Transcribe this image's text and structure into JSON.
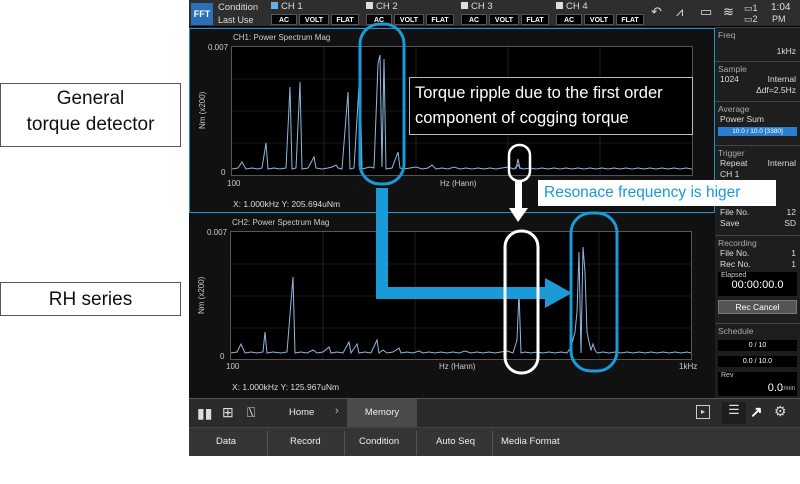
{
  "labels": {
    "general": "General\ntorque detector",
    "rh": "RH series"
  },
  "topbar": {
    "mode": "FFT",
    "condition": "Condition",
    "last_use": "Last Use",
    "channels": [
      {
        "name": "CH 1"
      },
      {
        "name": "CH 2"
      },
      {
        "name": "CH 3"
      },
      {
        "name": "CH 4"
      }
    ],
    "tags": [
      "AC",
      "VOLT",
      "FLAT"
    ],
    "time": "1:04",
    "ampm": "PM",
    "batt1": "1",
    "batt2": "2"
  },
  "side": {
    "freq_h": "Freq",
    "freq_v": "1kHz",
    "sample_h": "Sample",
    "sample_n": "1024",
    "sample_mode": "Internal",
    "sample_df": "Δdf=2.5Hz",
    "avg_h": "Average",
    "avg_mode": "Power Sum",
    "avg_bar": "10.0 / 10.0 [3380]",
    "trig_h": "Trigger",
    "trig_repeat": "Repeat",
    "trig_mode": "Internal",
    "trig_ch": "CH 1",
    "file_no_lbl": "File No.",
    "file_no": "12",
    "save_lbl": "Save",
    "save_v": "SD",
    "rec_h": "Recording",
    "rec_file_lbl": "File No.",
    "rec_file": "1",
    "rec_no_lbl": "Rec No.",
    "rec_no": "1",
    "elapsed_lbl": "Elapsed",
    "elapsed": "00:00:00.0",
    "rec_cancel": "Rec Cancel",
    "sched_h": "Schedule",
    "sched1": "0 / 10",
    "sched2": "0.0 / 10.0",
    "rev_lbl": "Rev",
    "rev_v": "0.0",
    "rev_unit": "r/min"
  },
  "graph1": {
    "title": "CH1: Power Spectrum Mag",
    "ymax": "0.007",
    "ymin": "0",
    "ylabel": "Nm (x200)",
    "xmin": "100",
    "xlabel": "Hz (Hann)",
    "readout": "X: 1.000kHz Y: 205.694uNm"
  },
  "graph2": {
    "title": "CH2: Power Spectrum Mag",
    "ymax": "0.007",
    "ymin": "0",
    "ylabel": "Nm (x200)",
    "xmin": "100",
    "xmax": "1kHz",
    "xlabel": "Hz (Hann)",
    "readout": "X: 1.000kHz Y: 125.967uNm"
  },
  "bottombar": {
    "home": "Home",
    "memory": "Memory"
  },
  "menubar": {
    "data": "Data",
    "record": "Record",
    "condition": "Condition",
    "autoseq": "Auto Seq",
    "media": "Media Format"
  },
  "annotations": {
    "ripple_line1": "Torque ripple due to the first order",
    "ripple_line2": "component of cogging torque",
    "resonance": "Resonace frequency is higer"
  },
  "colors": {
    "accent": "#1a9ad6",
    "trace": "#8fb8e0"
  }
}
